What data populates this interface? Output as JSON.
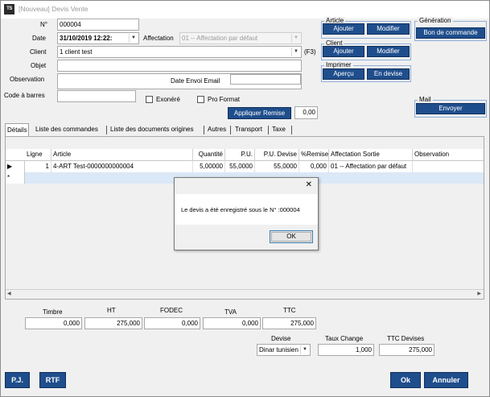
{
  "window": {
    "title": "[Nouveau] Devis Vente",
    "app_icon": "TS"
  },
  "form": {
    "numero_label": "N°",
    "numero_value": "000004",
    "date_label": "Date",
    "date_value": "31/10/2019 12:22:",
    "affectation_label": "Affectation",
    "affectation_value": "01 -- Affectation par défaut",
    "client_label": "Client",
    "client_value": "1 client test",
    "client_hint": "(F3)",
    "objet_label": "Objet",
    "objet_value": "",
    "observation_label": "Observation",
    "observation_value": "",
    "date_envoi_label": "Date Envoi Email",
    "date_envoi_value": "",
    "code_barres_label": "Code à barres",
    "code_barres_value": "",
    "exonere_label": "Exonéré",
    "exonere_checked": false,
    "pro_format_label": "Pro Format",
    "pro_format_checked": false,
    "appliquer_remise_label": "Appliquer Remise",
    "remise_value": "0,00"
  },
  "groups": {
    "article": {
      "title": "Article",
      "ajouter": "Ajouter",
      "modifier": "Modifier"
    },
    "client": {
      "title": "Client",
      "ajouter": "Ajouter",
      "modifier": "Modifier"
    },
    "imprimer": {
      "title": "Imprimer",
      "apercu": "Aperçu",
      "en_devise": "En devise"
    },
    "generation": {
      "title": "Génération",
      "bon_commande": "Bon de commande"
    },
    "mail": {
      "title": "Mail",
      "envoyer": "Envoyer"
    }
  },
  "tabs": [
    "Détails",
    "Liste des commandes",
    "Liste des documents origines",
    "Autres",
    "Transport",
    "Taxe"
  ],
  "grid": {
    "columns": [
      "Ligne",
      "Article",
      "Quantité",
      "P.U.",
      "P.U. Devise",
      "%Remise",
      "Affectation Sortie",
      "Observation"
    ],
    "rows": [
      [
        "1",
        "4-ART Test-0000000000004",
        "5,00000",
        "55,0000",
        "55,0000",
        "0,000",
        "01 -- Affectation par défaut",
        ""
      ]
    ],
    "row_indicator": "▶",
    "new_row_indicator": "*"
  },
  "totals": {
    "timbre_label": "Timbre",
    "timbre_value": "0,000",
    "ht_label": "HT",
    "ht_value": "275,000",
    "fodec_label": "FODEC",
    "fodec_value": "0,000",
    "tva_label": "TVA",
    "tva_value": "0,000",
    "ttc_label": "TTC",
    "ttc_value": "275,000"
  },
  "currency": {
    "devise_label": "Devise",
    "devise_value": "Dinar tunisien",
    "taux_label": "Taux Change",
    "taux_value": "1,000",
    "ttc_devises_label": "TTC Devises",
    "ttc_devises_value": "275,000"
  },
  "dialog": {
    "close": "✕",
    "message": "Le devis a été enregistré sous le N° :000004",
    "ok": "OK"
  },
  "footer": {
    "pj": "P.J.",
    "rtf": "RTF",
    "ok": "Ok",
    "annuler": "Annuler"
  },
  "colors": {
    "button_blue": "#1f4e8c",
    "group_border": "#8faed8",
    "row_select": "#dbe8f7"
  }
}
